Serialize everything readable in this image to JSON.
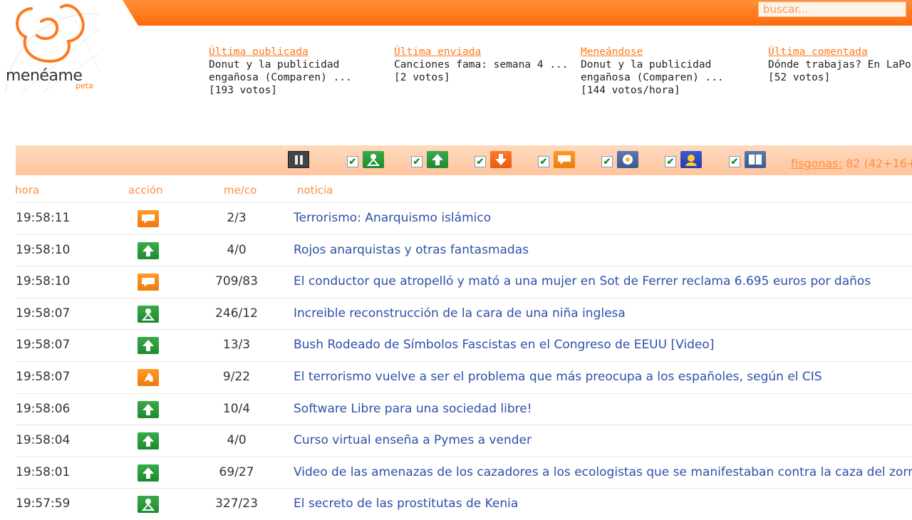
{
  "brand": {
    "name": "menéame",
    "sub": "peta"
  },
  "search": {
    "placeholder": "buscar..."
  },
  "summary": [
    {
      "title": "Última publicada",
      "line1": "Donut y la publicidad",
      "line2": "engañosa (Comparen) ...",
      "votes": "[193 votos]"
    },
    {
      "title": "Última enviada",
      "line1": "Canciones fama: semana 4 ...",
      "line2": "[2 votos]",
      "votes": ""
    },
    {
      "title": "Meneándose",
      "line1": "Donut y la publicidad",
      "line2": "engañosa (Comparen) ...",
      "votes": "[144 votos/hora]"
    },
    {
      "title": "Última comentada",
      "line1": "Dónde trabajas? En LaPo",
      "line2": "[52 votos]",
      "votes": ""
    }
  ],
  "filters": [
    {
      "icon": "published-icon",
      "color": "green",
      "checked": "✔"
    },
    {
      "icon": "vote-up-icon",
      "color": "green",
      "checked": "✔"
    },
    {
      "icon": "vote-down-icon",
      "color": "red",
      "checked": "✔"
    },
    {
      "icon": "comment-icon",
      "color": "orange",
      "checked": "✔"
    },
    {
      "icon": "new-icon",
      "color": "slate",
      "checked": "✔"
    },
    {
      "icon": "user-icon",
      "color": "blue",
      "checked": "✔"
    },
    {
      "icon": "post-icon",
      "color": "slate",
      "checked": "✔"
    }
  ],
  "visitors": {
    "label": "fisgonas:",
    "value": "82 (42+16+"
  },
  "columns": {
    "hora": "hora",
    "accion": "acción",
    "meco": "me/co",
    "noticia": "noticia"
  },
  "rows": [
    {
      "time": "19:58:11",
      "action": "comment",
      "meco": "2/3",
      "title": "Terrorismo: Anarquismo islámico"
    },
    {
      "time": "19:58:10",
      "action": "vote",
      "meco": "4/0",
      "title": "Rojos anarquistas y otras fantasmadas"
    },
    {
      "time": "19:58:10",
      "action": "comment",
      "meco": "709/83",
      "title": "El conductor que atropelló y mató a una mujer en Sot de Ferrer reclama 6.695 euros por daños"
    },
    {
      "time": "19:58:07",
      "action": "published",
      "meco": "246/12",
      "title": "Increible reconstrucción de la cara de una niña inglesa"
    },
    {
      "time": "19:58:07",
      "action": "vote",
      "meco": "13/3",
      "title": "Bush Rodeado de Símbolos Fascistas en el Congreso de EEUU [Video]"
    },
    {
      "time": "19:58:07",
      "action": "new",
      "meco": "9/22",
      "title": "El terrorismo vuelve a ser el problema que más preocupa a los españoles, según el CIS"
    },
    {
      "time": "19:58:06",
      "action": "vote",
      "meco": "10/4",
      "title": "Software Libre para una sociedad libre!"
    },
    {
      "time": "19:58:04",
      "action": "vote",
      "meco": "4/0",
      "title": "Curso virtual enseña a Pymes a vender"
    },
    {
      "time": "19:58:01",
      "action": "vote",
      "meco": "69/27",
      "title": "Video de las amenazas de los cazadores a los ecologistas que se manifestaban contra la caza del zorro"
    },
    {
      "time": "19:57:59",
      "action": "published",
      "meco": "327/23",
      "title": "El secreto de las prostitutas de Kenia"
    }
  ]
}
